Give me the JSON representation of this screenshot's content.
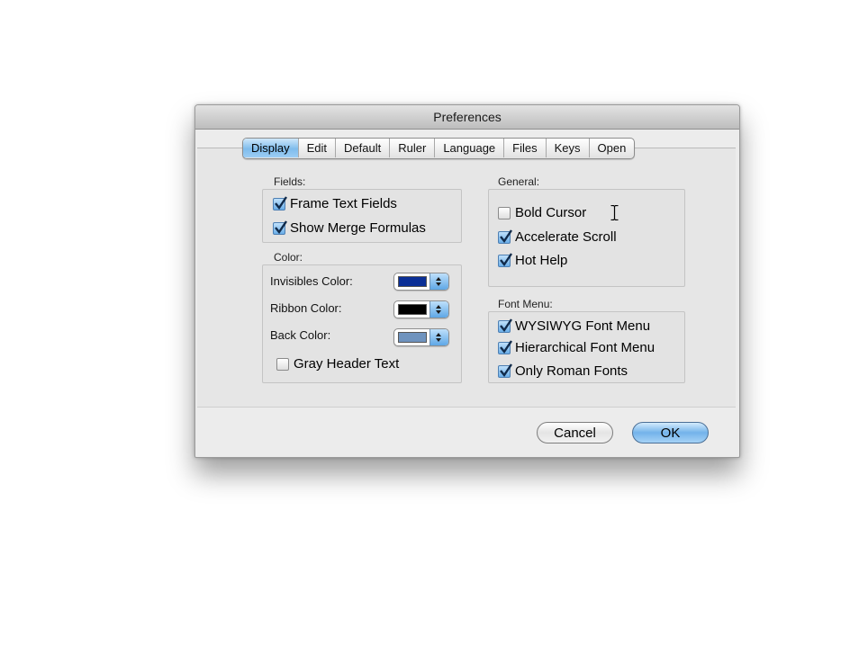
{
  "window": {
    "title": "Preferences"
  },
  "tabs": [
    {
      "label": "Display",
      "selected": true
    },
    {
      "label": "Edit",
      "selected": false
    },
    {
      "label": "Default",
      "selected": false
    },
    {
      "label": "Ruler",
      "selected": false
    },
    {
      "label": "Language",
      "selected": false
    },
    {
      "label": "Files",
      "selected": false
    },
    {
      "label": "Keys",
      "selected": false
    },
    {
      "label": "Open",
      "selected": false
    }
  ],
  "fields": {
    "label": "Fields:",
    "frame_text_fields": {
      "label": "Frame Text Fields",
      "checked": true
    },
    "show_merge_formulas": {
      "label": "Show Merge Formulas",
      "checked": true
    }
  },
  "color": {
    "label": "Color:",
    "invisibles": {
      "label": "Invisibles Color:",
      "swatch": "#0a2f96"
    },
    "ribbon": {
      "label": "Ribbon Color:",
      "swatch": "#000000"
    },
    "back": {
      "label": "Back Color:",
      "swatch": "#6f93be"
    },
    "gray_header_text": {
      "label": "Gray Header Text",
      "checked": false
    }
  },
  "general": {
    "label": "General:",
    "bold_cursor": {
      "label": "Bold Cursor",
      "checked": false
    },
    "accelerate_scroll": {
      "label": "Accelerate Scroll",
      "checked": true
    },
    "hot_help": {
      "label": "Hot Help",
      "checked": true
    }
  },
  "font_menu": {
    "label": "Font Menu:",
    "wysiwyg": {
      "label": "WYSIWYG Font Menu",
      "checked": true
    },
    "hierarchical": {
      "label": "Hierarchical Font Menu",
      "checked": true
    },
    "only_roman": {
      "label": "Only Roman Fonts",
      "checked": true
    }
  },
  "buttons": {
    "cancel": "Cancel",
    "ok": "OK"
  },
  "colors": {
    "accent": "#6aaee8",
    "window_bg": "#ececec"
  },
  "icons": {
    "checkmark": "checkmark-icon",
    "cursor": "i-beam-cursor-icon"
  }
}
